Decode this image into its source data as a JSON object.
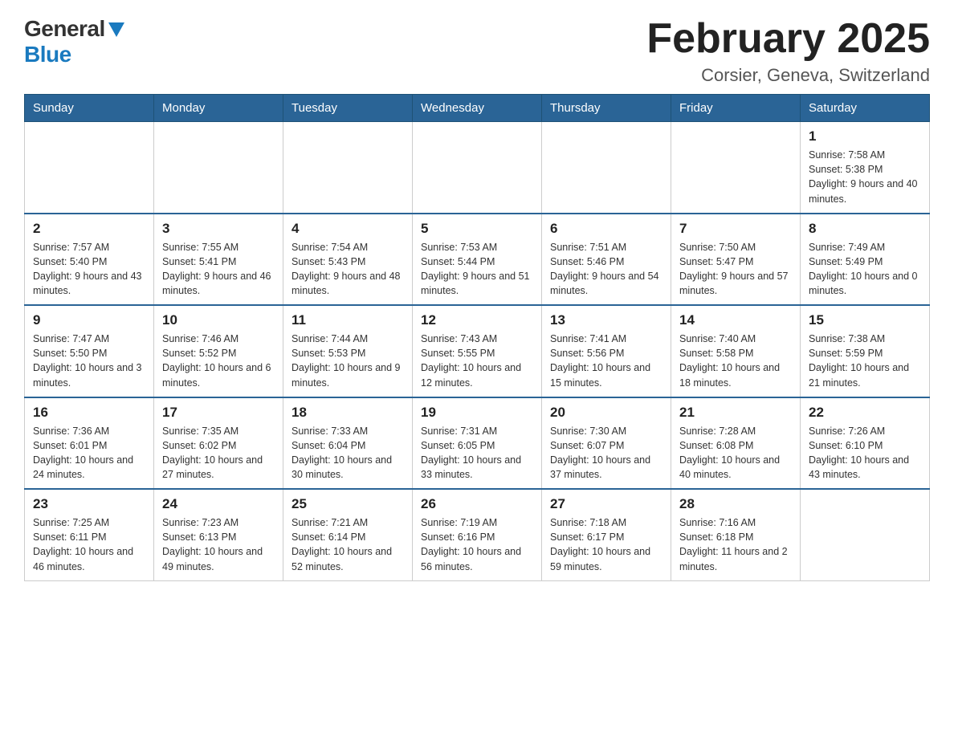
{
  "header": {
    "logo_general": "General",
    "logo_blue": "Blue",
    "title": "February 2025",
    "subtitle": "Corsier, Geneva, Switzerland"
  },
  "days_of_week": [
    "Sunday",
    "Monday",
    "Tuesday",
    "Wednesday",
    "Thursday",
    "Friday",
    "Saturday"
  ],
  "weeks": [
    {
      "days": [
        {
          "number": "",
          "info": ""
        },
        {
          "number": "",
          "info": ""
        },
        {
          "number": "",
          "info": ""
        },
        {
          "number": "",
          "info": ""
        },
        {
          "number": "",
          "info": ""
        },
        {
          "number": "",
          "info": ""
        },
        {
          "number": "1",
          "info": "Sunrise: 7:58 AM\nSunset: 5:38 PM\nDaylight: 9 hours\nand 40 minutes."
        }
      ]
    },
    {
      "days": [
        {
          "number": "2",
          "info": "Sunrise: 7:57 AM\nSunset: 5:40 PM\nDaylight: 9 hours\nand 43 minutes."
        },
        {
          "number": "3",
          "info": "Sunrise: 7:55 AM\nSunset: 5:41 PM\nDaylight: 9 hours\nand 46 minutes."
        },
        {
          "number": "4",
          "info": "Sunrise: 7:54 AM\nSunset: 5:43 PM\nDaylight: 9 hours\nand 48 minutes."
        },
        {
          "number": "5",
          "info": "Sunrise: 7:53 AM\nSunset: 5:44 PM\nDaylight: 9 hours\nand 51 minutes."
        },
        {
          "number": "6",
          "info": "Sunrise: 7:51 AM\nSunset: 5:46 PM\nDaylight: 9 hours\nand 54 minutes."
        },
        {
          "number": "7",
          "info": "Sunrise: 7:50 AM\nSunset: 5:47 PM\nDaylight: 9 hours\nand 57 minutes."
        },
        {
          "number": "8",
          "info": "Sunrise: 7:49 AM\nSunset: 5:49 PM\nDaylight: 10 hours\nand 0 minutes."
        }
      ]
    },
    {
      "days": [
        {
          "number": "9",
          "info": "Sunrise: 7:47 AM\nSunset: 5:50 PM\nDaylight: 10 hours\nand 3 minutes."
        },
        {
          "number": "10",
          "info": "Sunrise: 7:46 AM\nSunset: 5:52 PM\nDaylight: 10 hours\nand 6 minutes."
        },
        {
          "number": "11",
          "info": "Sunrise: 7:44 AM\nSunset: 5:53 PM\nDaylight: 10 hours\nand 9 minutes."
        },
        {
          "number": "12",
          "info": "Sunrise: 7:43 AM\nSunset: 5:55 PM\nDaylight: 10 hours\nand 12 minutes."
        },
        {
          "number": "13",
          "info": "Sunrise: 7:41 AM\nSunset: 5:56 PM\nDaylight: 10 hours\nand 15 minutes."
        },
        {
          "number": "14",
          "info": "Sunrise: 7:40 AM\nSunset: 5:58 PM\nDaylight: 10 hours\nand 18 minutes."
        },
        {
          "number": "15",
          "info": "Sunrise: 7:38 AM\nSunset: 5:59 PM\nDaylight: 10 hours\nand 21 minutes."
        }
      ]
    },
    {
      "days": [
        {
          "number": "16",
          "info": "Sunrise: 7:36 AM\nSunset: 6:01 PM\nDaylight: 10 hours\nand 24 minutes."
        },
        {
          "number": "17",
          "info": "Sunrise: 7:35 AM\nSunset: 6:02 PM\nDaylight: 10 hours\nand 27 minutes."
        },
        {
          "number": "18",
          "info": "Sunrise: 7:33 AM\nSunset: 6:04 PM\nDaylight: 10 hours\nand 30 minutes."
        },
        {
          "number": "19",
          "info": "Sunrise: 7:31 AM\nSunset: 6:05 PM\nDaylight: 10 hours\nand 33 minutes."
        },
        {
          "number": "20",
          "info": "Sunrise: 7:30 AM\nSunset: 6:07 PM\nDaylight: 10 hours\nand 37 minutes."
        },
        {
          "number": "21",
          "info": "Sunrise: 7:28 AM\nSunset: 6:08 PM\nDaylight: 10 hours\nand 40 minutes."
        },
        {
          "number": "22",
          "info": "Sunrise: 7:26 AM\nSunset: 6:10 PM\nDaylight: 10 hours\nand 43 minutes."
        }
      ]
    },
    {
      "days": [
        {
          "number": "23",
          "info": "Sunrise: 7:25 AM\nSunset: 6:11 PM\nDaylight: 10 hours\nand 46 minutes."
        },
        {
          "number": "24",
          "info": "Sunrise: 7:23 AM\nSunset: 6:13 PM\nDaylight: 10 hours\nand 49 minutes."
        },
        {
          "number": "25",
          "info": "Sunrise: 7:21 AM\nSunset: 6:14 PM\nDaylight: 10 hours\nand 52 minutes."
        },
        {
          "number": "26",
          "info": "Sunrise: 7:19 AM\nSunset: 6:16 PM\nDaylight: 10 hours\nand 56 minutes."
        },
        {
          "number": "27",
          "info": "Sunrise: 7:18 AM\nSunset: 6:17 PM\nDaylight: 10 hours\nand 59 minutes."
        },
        {
          "number": "28",
          "info": "Sunrise: 7:16 AM\nSunset: 6:18 PM\nDaylight: 11 hours\nand 2 minutes."
        },
        {
          "number": "",
          "info": ""
        }
      ]
    }
  ]
}
